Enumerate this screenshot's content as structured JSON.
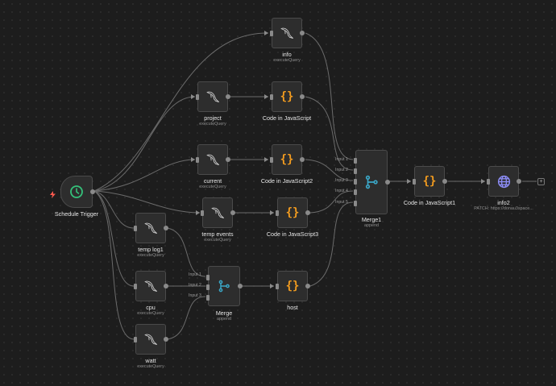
{
  "nodes": {
    "info": {
      "label": "info",
      "sub": "executeQuery"
    },
    "project": {
      "label": "project",
      "sub": "executeQuery"
    },
    "current": {
      "label": "current",
      "sub": "executeQuery"
    },
    "temp_events": {
      "label": "temp events",
      "sub": "executeQuery"
    },
    "temp_log1": {
      "label": "temp log1",
      "sub": "executeQuery"
    },
    "cpu": {
      "label": "cpu",
      "sub": "executeQuery"
    },
    "watt": {
      "label": "watt",
      "sub": "executeQuery"
    },
    "schedule": {
      "label": "Schedule Trigger"
    },
    "code_js": {
      "label": "Code in JavaScript"
    },
    "code_js2": {
      "label": "Code in JavaScript2"
    },
    "code_js3": {
      "label": "Code in JavaScript3"
    },
    "host": {
      "label": "host"
    },
    "merge": {
      "label": "Merge",
      "sub": "append",
      "inputs": [
        "Input 1",
        "Input 2",
        "Input 3"
      ]
    },
    "merge1": {
      "label": "Merge1",
      "sub": "append",
      "inputs": [
        "Input 1",
        "Input 2",
        "Input 3",
        "Input 4",
        "Input 5"
      ]
    },
    "code_js1": {
      "label": "Code in JavaScript1"
    },
    "info2": {
      "label": "info2",
      "sub": "PATCH: https://donau3space..."
    }
  },
  "icons": {
    "database": "dolphin-icon",
    "code": "code-braces-icon",
    "merge": "merge-icon",
    "trigger": "clock-icon",
    "http": "globe-icon",
    "bolt": "lightning-icon"
  },
  "colors": {
    "code": "#f39c1f",
    "merge": "#3aa6c6",
    "trigger": "#35c17a",
    "http": "#8c8cf5",
    "bolt": "#ff5a4f"
  },
  "add_button": "+",
  "code_glyph": "{}"
}
